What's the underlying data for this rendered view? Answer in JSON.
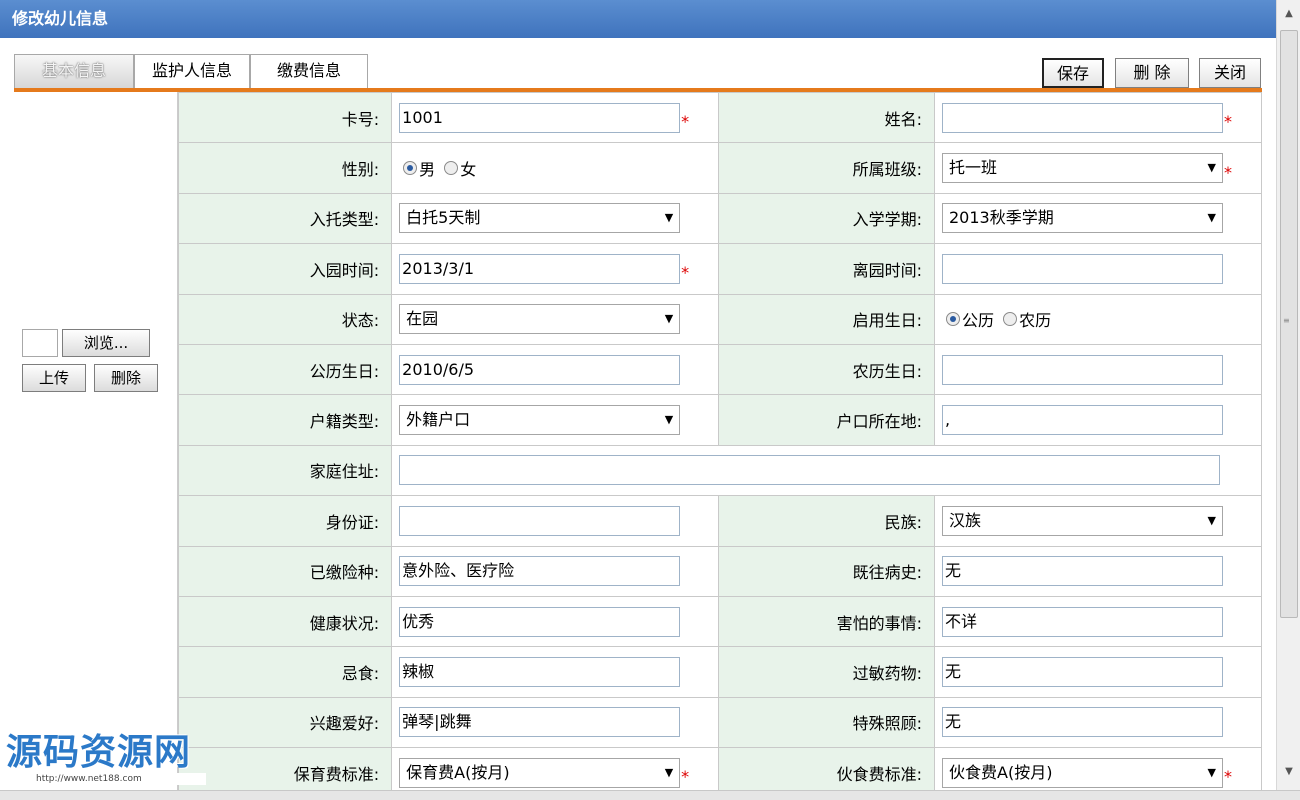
{
  "window": {
    "title": "修改幼儿信息"
  },
  "tabs": [
    {
      "label": "基本信息",
      "active": true
    },
    {
      "label": "监护人信息",
      "active": false
    },
    {
      "label": "缴费信息",
      "active": false
    }
  ],
  "toolbar": {
    "save_label": "保存",
    "delete_label": "删 除",
    "close_label": "关闭"
  },
  "photo": {
    "browse_label": "浏览...",
    "upload_label": "上传",
    "delete_label": "删除"
  },
  "required_mark": "*",
  "form": {
    "card_no": {
      "label": "卡号:",
      "value": "1001"
    },
    "name": {
      "label": "姓名:",
      "value": ""
    },
    "gender": {
      "label": "性别:",
      "options": [
        "男",
        "女"
      ],
      "selected": "男"
    },
    "class": {
      "label": "所属班级:",
      "value": "托一班"
    },
    "care_type": {
      "label": "入托类型:",
      "value": "白托5天制"
    },
    "term": {
      "label": "入学学期:",
      "value": "2013秋季学期"
    },
    "enroll_date": {
      "label": "入园时间:",
      "value": "2013/3/1"
    },
    "leave_date": {
      "label": "离园时间:",
      "value": ""
    },
    "status": {
      "label": "状态:",
      "value": "在园"
    },
    "birthday_type": {
      "label": "启用生日:",
      "options": [
        "公历",
        "农历"
      ],
      "selected": "公历"
    },
    "solar_birthday": {
      "label": "公历生日:",
      "value": "2010/6/5"
    },
    "lunar_birthday": {
      "label": "农历生日:",
      "value": ""
    },
    "hukou_type": {
      "label": "户籍类型:",
      "value": "外籍户口"
    },
    "hukou_place": {
      "label": "户口所在地:",
      "value": ","
    },
    "address": {
      "label": "家庭住址:",
      "value": ""
    },
    "id_card": {
      "label": "身份证:",
      "value": ""
    },
    "ethnicity": {
      "label": "民族:",
      "value": "汉族"
    },
    "insurance": {
      "label": "已缴险种:",
      "value": "意外险、医疗险"
    },
    "medical_history": {
      "label": "既往病史:",
      "value": "无"
    },
    "health": {
      "label": "健康状况:",
      "value": "优秀"
    },
    "fears": {
      "label": "害怕的事情:",
      "value": "不详"
    },
    "diet_restriction": {
      "label": "忌食:",
      "value": "辣椒"
    },
    "allergy": {
      "label": "过敏药物:",
      "value": "无"
    },
    "hobbies": {
      "label": "兴趣爱好:",
      "value": "弹琴|跳舞"
    },
    "special_care": {
      "label": "特殊照顾:",
      "value": "无"
    },
    "nursery_fee": {
      "label": "保育费标准:",
      "value": "保育费A(按月)"
    },
    "meal_fee": {
      "label": "伙食费标准:",
      "value": "伙食费A(按月)"
    }
  },
  "watermark": {
    "title": "源码资源网",
    "url": "http://www.net188.com"
  }
}
